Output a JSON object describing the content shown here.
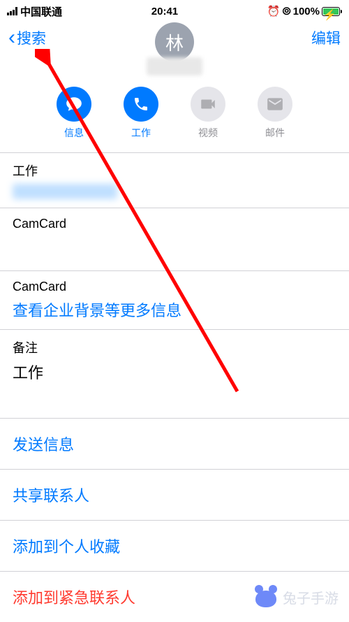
{
  "status": {
    "carrier": "中国联通",
    "time": "20:41",
    "alarm": "⏰",
    "lock": "🔒",
    "battery": "100%"
  },
  "nav": {
    "back": "搜索",
    "edit": "编辑"
  },
  "avatar": {
    "initial": "林"
  },
  "actions": {
    "message": "信息",
    "work": "工作",
    "video": "视频",
    "mail": "邮件"
  },
  "sections": {
    "work_label": "工作",
    "camcard1": "CamCard",
    "camcard2": "CamCard",
    "camcard_link": "查看企业背景等更多信息",
    "notes_label": "备注",
    "notes_value": "工作",
    "send_message": "发送信息",
    "share_contact": "共享联系人",
    "add_favorite": "添加到个人收藏",
    "add_emergency": "添加到紧急联系人"
  },
  "watermark": "兔子手游"
}
